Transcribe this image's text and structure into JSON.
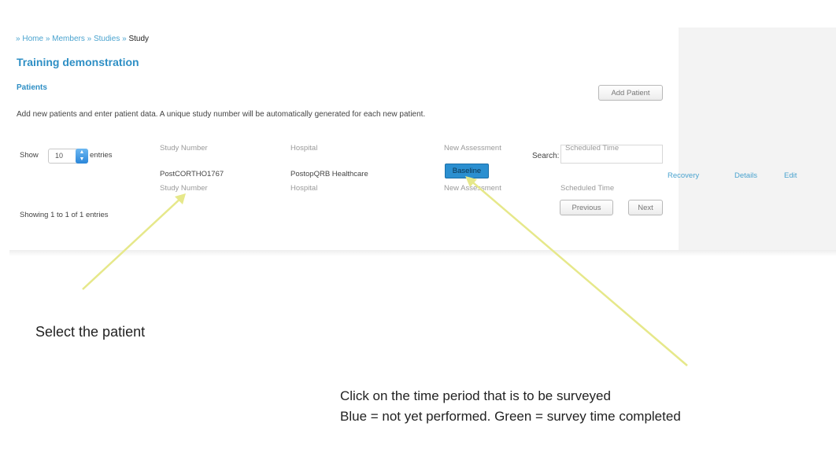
{
  "breadcrumb": {
    "items": [
      "Home",
      "Members",
      "Studies"
    ],
    "current": "Study",
    "separator": "»"
  },
  "study_title": "Training demonstration",
  "patients_heading": "Patients",
  "add_patient_label": "Add Patient",
  "intro_text": "Add new patients and enter patient data. A unique study number will be automatically generated for each new patient.",
  "table_controls": {
    "show_label": "Show",
    "entries_value": "10",
    "entries_label": "entries",
    "search_label": "Search:",
    "showing_text": "Showing 1 to 1 of 1 entries",
    "previous_label": "Previous",
    "next_label": "Next"
  },
  "table": {
    "columns": [
      "Study Number",
      "Hospital",
      "New Assessment",
      "Scheduled Time"
    ],
    "rows": [
      {
        "study_number": "PostCORTHO1767",
        "hospital": "PostopQRB Healthcare",
        "assessment": "Baseline",
        "actions": [
          "Recovery",
          "Details",
          "Edit"
        ]
      }
    ]
  },
  "annotations": {
    "select_patient": "Select the patient",
    "click_period": "Click on the time period that is to be surveyed",
    "color_legend": "Blue = not yet performed. Green = survey time completed"
  },
  "colors": {
    "link": "#4aa3cf",
    "title": "#2e8fc5",
    "baseline_button": "#2b8fd0",
    "arrow": "#e6e88a"
  },
  "icons": {
    "entries_select_arrow": "updown-chevron-icon",
    "annotation_arrows": "arrow-icon"
  }
}
